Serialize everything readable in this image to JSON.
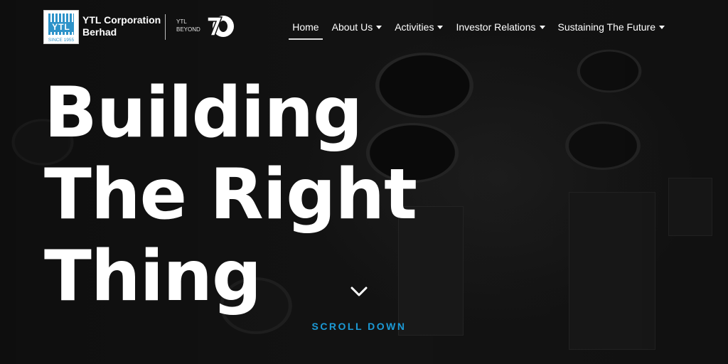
{
  "brand": {
    "logo_text": "YTL",
    "since": "SINCE 1955",
    "name": "YTL Corporation\nBerhad",
    "beyond": "YTL\nBEYOND",
    "badge_icon": "seventy-anniversary-icon"
  },
  "nav": {
    "items": [
      {
        "label": "Home",
        "active": true,
        "dropdown": false
      },
      {
        "label": "About Us",
        "active": false,
        "dropdown": true
      },
      {
        "label": "Activities",
        "active": false,
        "dropdown": true
      },
      {
        "label": "Investor Relations",
        "active": false,
        "dropdown": true
      },
      {
        "label": "Sustaining The Future",
        "active": false,
        "dropdown": true
      }
    ]
  },
  "hero": {
    "headline_lines": [
      "Building",
      "The Right",
      "Thing"
    ],
    "scroll_icon": "chevron-down-icon",
    "scroll_label": "SCROLL DOWN"
  },
  "colors": {
    "accent": "#1c9ad6",
    "logo_blue": "#2e93c9",
    "text": "#ffffff"
  }
}
